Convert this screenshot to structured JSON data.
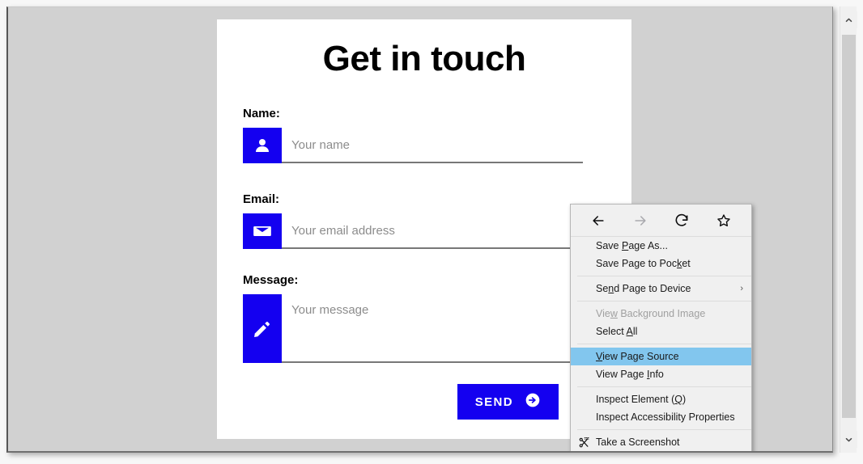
{
  "window": {
    "background_color": "#d1d1d1",
    "card_background": "#ffffff"
  },
  "form": {
    "title": "Get in touch",
    "accent_color": "#1400f0",
    "fields": [
      {
        "label": "Name:",
        "placeholder": "Your name",
        "value": "",
        "icon": "person-icon"
      },
      {
        "label": "Email:",
        "placeholder": "Your email address",
        "value": "",
        "icon": "envelope-icon"
      },
      {
        "label": "Message:",
        "placeholder": "Your message",
        "value": "",
        "icon": "pencil-icon"
      }
    ],
    "submit": {
      "label": "SEND",
      "icon": "arrow-circle-right-icon"
    }
  },
  "context_menu": {
    "highlight_color": "#82c6ee",
    "background_color": "#f0f0f0",
    "nav": [
      {
        "name": "back-button",
        "icon": "arrow-left-icon",
        "enabled": true
      },
      {
        "name": "forward-button",
        "icon": "arrow-right-icon",
        "enabled": false
      },
      {
        "name": "reload-button",
        "icon": "reload-icon",
        "enabled": true
      },
      {
        "name": "bookmark-button",
        "icon": "star-icon",
        "enabled": true
      }
    ],
    "items": [
      {
        "label": "Save Page As...",
        "accel": "P",
        "state": "normal",
        "submenu": false,
        "icon": null
      },
      {
        "label": "Save Page to Pocket",
        "accel": "k",
        "state": "normal",
        "submenu": false,
        "icon": null
      },
      {
        "separator": true
      },
      {
        "label": "Send Page to Device",
        "accel": "n",
        "state": "normal",
        "submenu": true,
        "submenu_arrow": "›",
        "icon": null
      },
      {
        "separator": true
      },
      {
        "label": "View Background Image",
        "accel": "w",
        "state": "disabled",
        "submenu": false,
        "icon": null
      },
      {
        "label": "Select All",
        "accel": "A",
        "state": "normal",
        "submenu": false,
        "icon": null
      },
      {
        "separator": true
      },
      {
        "label": "View Page Source",
        "accel": "V",
        "state": "selected",
        "submenu": false,
        "icon": null
      },
      {
        "label": "View Page Info",
        "accel": "I",
        "state": "normal",
        "submenu": false,
        "icon": null
      },
      {
        "separator": true
      },
      {
        "label": "Inspect Element (Q)",
        "accel": "Q",
        "state": "normal",
        "submenu": false,
        "icon": null
      },
      {
        "label": "Inspect Accessibility Properties",
        "accel": null,
        "state": "normal",
        "submenu": false,
        "icon": null
      },
      {
        "separator": true
      },
      {
        "label": "Take a Screenshot",
        "accel": null,
        "state": "normal",
        "submenu": false,
        "icon": "scissors-icon"
      }
    ]
  },
  "scrollbar": {
    "up_arrow": "∧",
    "down_arrow": "∨",
    "thumb_color": "#cdcdcd",
    "track_color": "#f0f0f0"
  }
}
